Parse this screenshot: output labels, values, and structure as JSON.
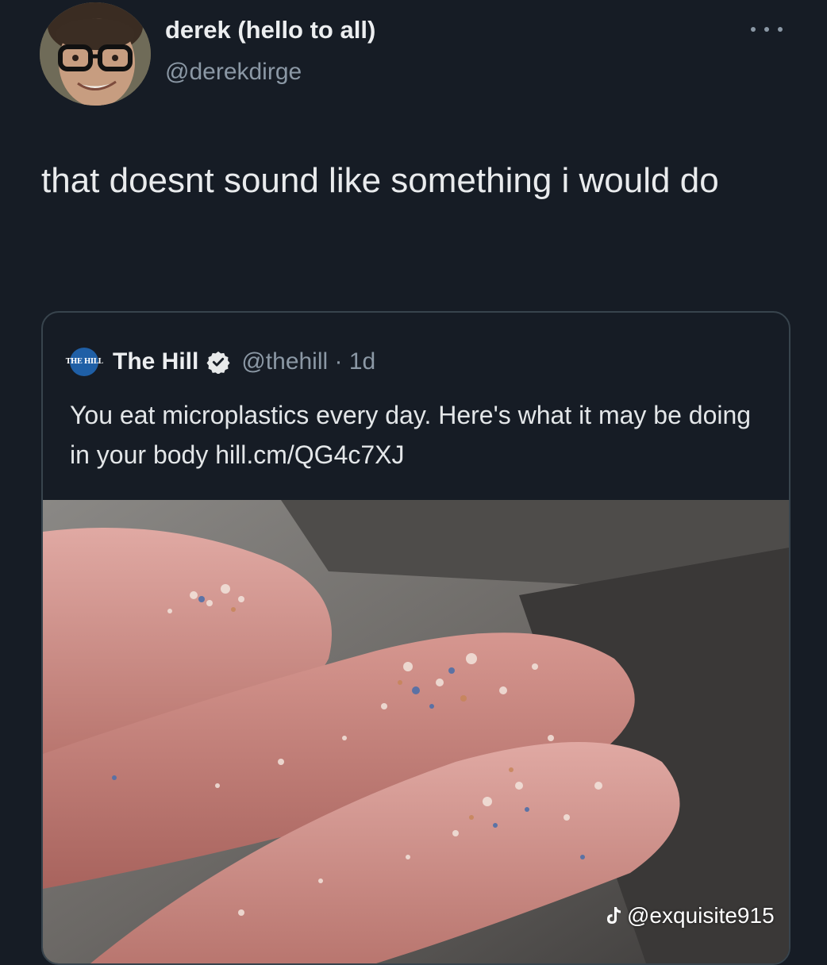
{
  "tweet": {
    "author": {
      "display_name": "derek (hello to all)",
      "handle": "@derekdirge",
      "avatar_icon": "profile-photo"
    },
    "more_icon": "ellipsis-icon",
    "text": "that doesnt sound like something i would do"
  },
  "quoted_tweet": {
    "logo_text": "THE HILL",
    "display_name": "The Hill",
    "verified_icon": "verified-badge-icon",
    "handle_time": "@thehill · 1d",
    "text": "You eat microplastics every day. Here's what it may be doing in your body hill.cm/QG4c7XJ",
    "image_subject": "fingers covered in microplastic flakes"
  },
  "watermark": {
    "icon": "tiktok-icon",
    "text": "@exquisite915"
  },
  "colors": {
    "background": "#161c25",
    "border": "#38444d",
    "secondary_text": "#8b98a5",
    "verified": "#e7e9ea",
    "hill_blue": "#1f5fa6"
  }
}
